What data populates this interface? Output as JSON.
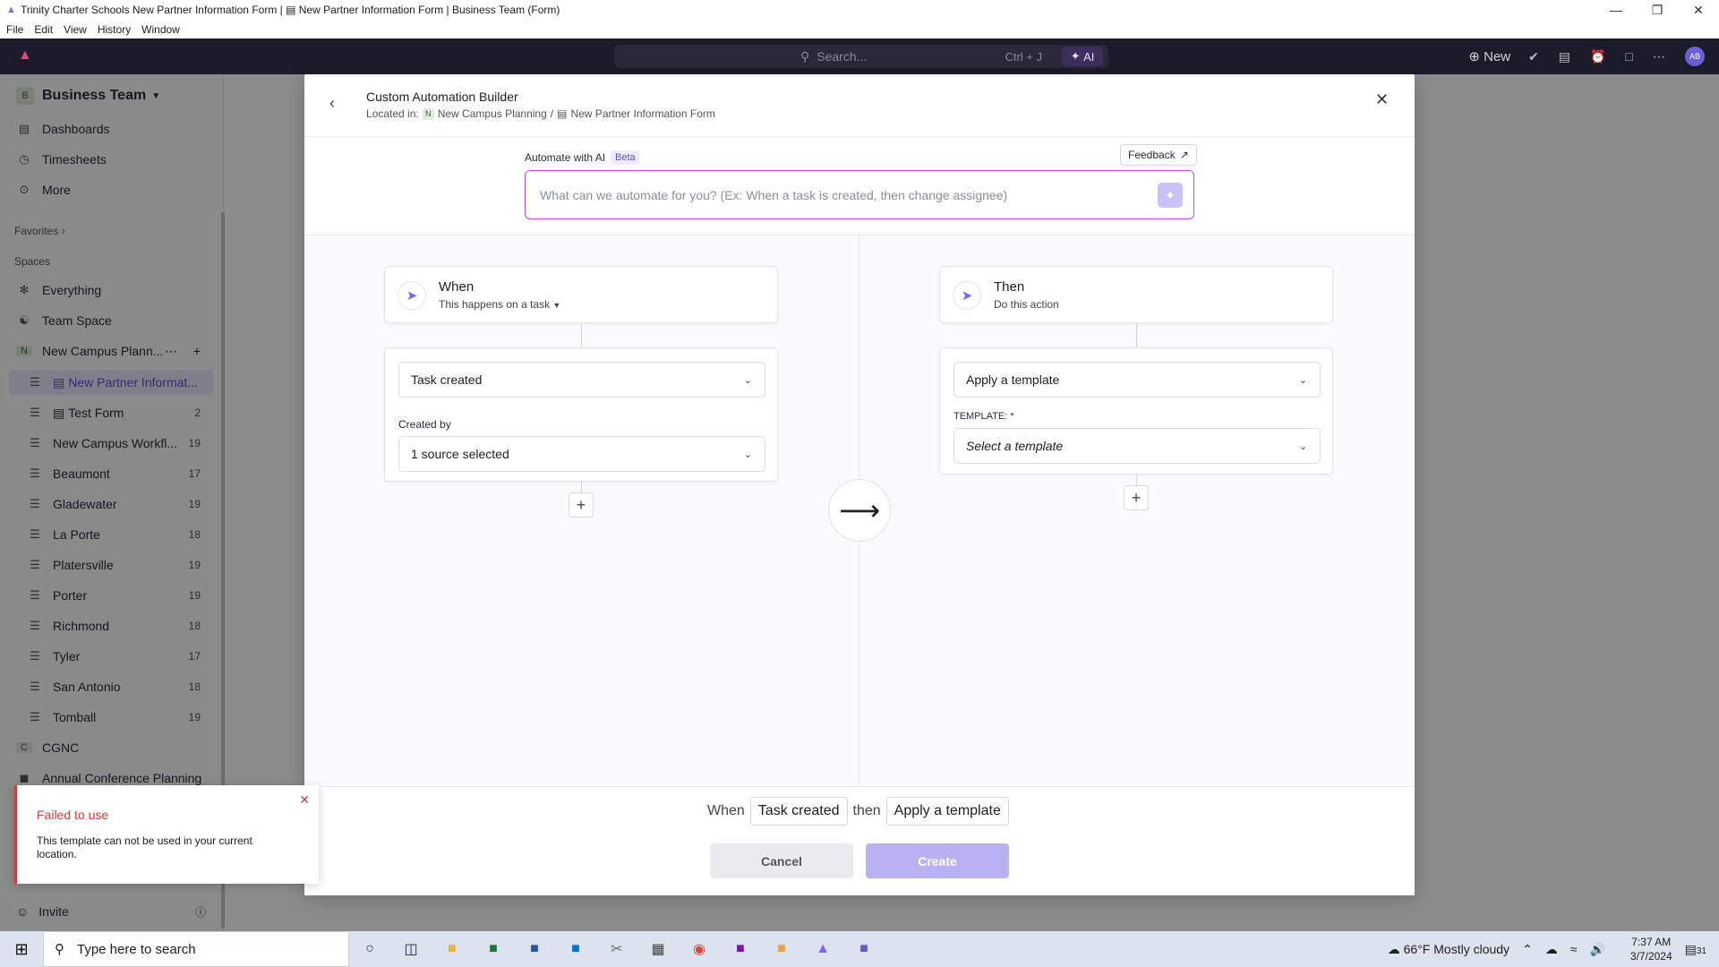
{
  "window": {
    "title": "Trinity Charter Schools New Partner Information Form | ▤ New Partner Information Form | Business Team (Form)",
    "menu": [
      "File",
      "Edit",
      "View",
      "History",
      "Window"
    ]
  },
  "appbar": {
    "search_placeholder": "Search...",
    "search_shortcut": "Ctrl + J",
    "ai_label": "AI",
    "new_label": "New",
    "avatar": "AB"
  },
  "sidebar": {
    "workspace_badge": "B",
    "workspace_name": "Business Team",
    "top_items": [
      {
        "label": "Dashboards",
        "icon": "dashboard-icon"
      },
      {
        "label": "Timesheets",
        "icon": "clock-icon"
      },
      {
        "label": "More",
        "icon": "more-icon"
      }
    ],
    "favorites_label": "Favorites",
    "spaces_label": "Spaces",
    "space_items": [
      {
        "label": "Everything"
      },
      {
        "label": "Team Space"
      },
      {
        "label": "New Campus Plann...",
        "badge": "N"
      },
      {
        "label": "New Partner Informat..."
      },
      {
        "label": "Test Form",
        "count": "2"
      },
      {
        "label": "New Campus Workfl...",
        "count": "19"
      },
      {
        "label": "Beaumont",
        "count": "17"
      },
      {
        "label": "Gladewater",
        "count": "19"
      },
      {
        "label": "La Porte",
        "count": "18"
      },
      {
        "label": "Platersville",
        "count": "19"
      },
      {
        "label": "Porter",
        "count": "19"
      },
      {
        "label": "Richmond",
        "count": "18"
      },
      {
        "label": "Tyler",
        "count": "17"
      },
      {
        "label": "San Antonio",
        "count": "18"
      },
      {
        "label": "Tomball",
        "count": "19"
      },
      {
        "label": "CGNC",
        "badge": "C"
      },
      {
        "label": "Annual Conference Planning"
      }
    ],
    "invite_label": "Invite"
  },
  "modal": {
    "title": "Custom Automation Builder",
    "location_prefix": "Located in:",
    "location_badge": "N",
    "location_space": "New Campus Planning",
    "location_sep": "/",
    "location_list": "New Partner Information Form",
    "ai_label": "Automate with AI",
    "ai_beta": "Beta",
    "feedback_label": "Feedback",
    "ai_placeholder": "What can we automate for you? (Ex: When a task is created, then change assignee)",
    "when": {
      "title": "When",
      "subtitle": "This happens on a task",
      "trigger_value": "Task created",
      "created_by_label": "Created by",
      "created_by_value": "1 source selected"
    },
    "then": {
      "title": "Then",
      "subtitle": "Do this action",
      "action_value": "Apply a template",
      "template_label": "TEMPLATE: *",
      "template_placeholder": "Select a template"
    },
    "summary": {
      "when_word": "When",
      "trigger": "Task created",
      "then_word": "then",
      "action": "Apply a template"
    },
    "cancel_label": "Cancel",
    "create_label": "Create"
  },
  "toast": {
    "title": "Failed to use",
    "message": "This template can not be used in your current location."
  },
  "taskbar": {
    "search_placeholder": "Type here to search",
    "weather": "66°F  Mostly cloudy",
    "time": "7:37 AM",
    "date": "3/7/2024",
    "notification_count": "31"
  }
}
